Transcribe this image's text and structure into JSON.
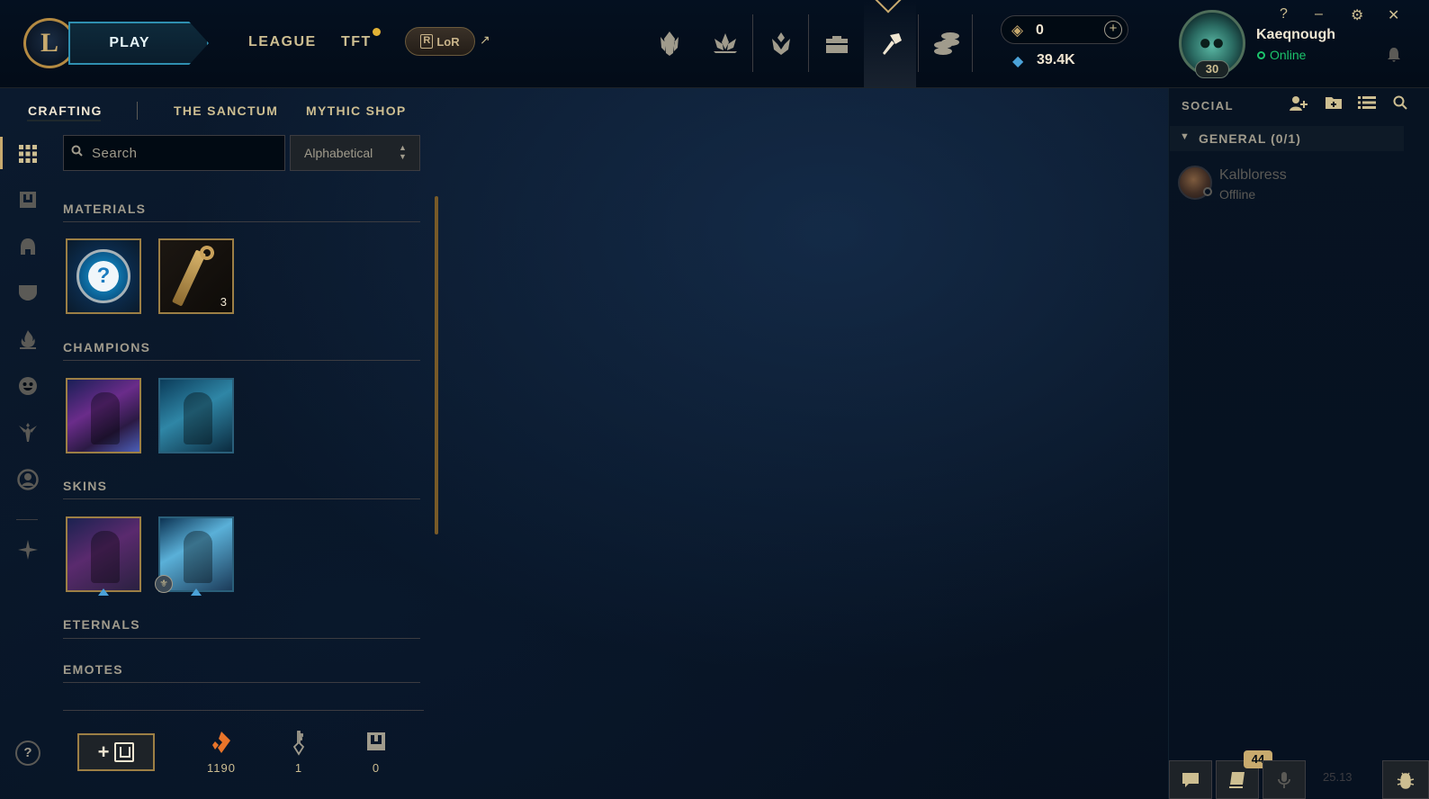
{
  "topbar": {
    "logo_letter": "L",
    "play_label": "PLAY",
    "nav": [
      {
        "label": "LEAGUE"
      },
      {
        "label": "TFT"
      }
    ],
    "lor_label": "LoR",
    "lor_r": "R",
    "lor_arrow": "↗",
    "store_icons": [
      "home-crest-icon",
      "clash-lotus-icon",
      "profile-shield-icon",
      "collection-bag-icon",
      "loot-hammer-icon",
      "store-coins-icon"
    ],
    "rp_value": "0",
    "be_value": "39.4K",
    "add_rp": "+",
    "username": "Kaeqnough",
    "status": "Online",
    "level": "30",
    "window_controls": [
      "?",
      "–",
      "⚙",
      "✕"
    ]
  },
  "subnav": {
    "tabs": [
      "CRAFTING",
      "THE SANCTUM",
      "MYTHIC SHOP"
    ],
    "active": "CRAFTING"
  },
  "filter": {
    "search_placeholder": "Search",
    "sort_value": "Alphabetical"
  },
  "inventory": {
    "sections": [
      {
        "title": "MATERIALS"
      },
      {
        "title": "CHAMPIONS"
      },
      {
        "title": "SKINS"
      },
      {
        "title": "ETERNALS"
      },
      {
        "title": "EMOTES"
      }
    ],
    "key_fragment_count": "3"
  },
  "bottom": {
    "add_chest_plus": "+",
    "currencies": [
      {
        "icon": "orange-essence-icon",
        "value": "1190",
        "color": "#e8742a"
      },
      {
        "icon": "key-icon",
        "value": "1",
        "color": "#a09b8c"
      },
      {
        "icon": "chest-icon",
        "value": "0",
        "color": "#a09b8c"
      }
    ]
  },
  "social": {
    "title": "SOCIAL",
    "group_title": "GENERAL (0/1)",
    "friends": [
      {
        "name": "Kalbloress",
        "status": "Offline"
      }
    ],
    "badge_count": "44",
    "version": "25.13"
  },
  "colors": {
    "gold": "#c8aa6e",
    "online": "#1cc36b",
    "blue_essence": "#4ba2d8",
    "background": "#010a13"
  }
}
